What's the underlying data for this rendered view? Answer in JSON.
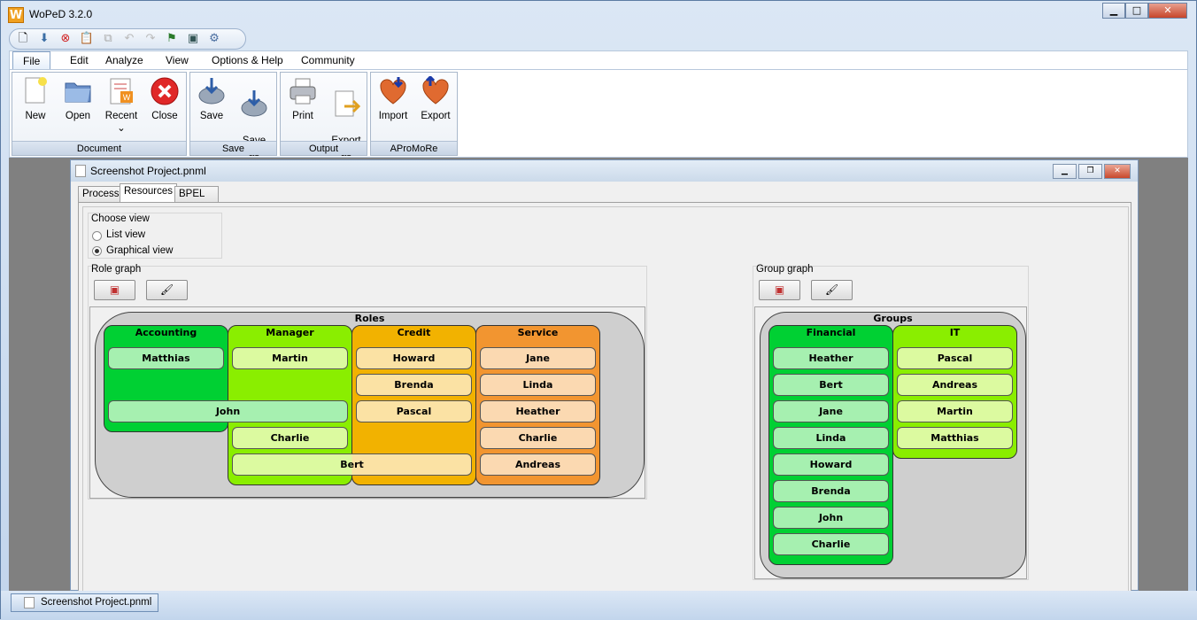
{
  "app": {
    "title": "WoPeD 3.2.0",
    "icon_letter": "W"
  },
  "window_buttons": [
    "minimize-icon",
    "maximize-icon",
    "close-icon"
  ],
  "quick_access": [
    "new-icon",
    "save-icon",
    "close-icon",
    "paste-icon",
    "copy-icon",
    "undo-icon",
    "redo-icon",
    "simulate-icon",
    "image-icon",
    "settings-icon"
  ],
  "menu": [
    "File",
    "Edit",
    "Analyze",
    "View",
    "Options & Help",
    "Community"
  ],
  "ribbon": {
    "groups": [
      {
        "label": "Document",
        "buttons": [
          {
            "label": "New",
            "icon": "new-doc-icon"
          },
          {
            "label": "Open",
            "icon": "folder-icon"
          },
          {
            "label": "Recent",
            "icon": "recent-icon",
            "dropdown": "⌄"
          },
          {
            "label": "Close",
            "icon": "close-icon"
          }
        ]
      },
      {
        "label": "Save",
        "buttons": [
          {
            "label": "Save",
            "icon": "save-icon"
          },
          {
            "label": "Save\nas",
            "icon": "save-as-icon"
          }
        ]
      },
      {
        "label": "Output",
        "buttons": [
          {
            "label": "Print",
            "icon": "printer-icon"
          },
          {
            "label": "Export\nas",
            "icon": "export-icon"
          }
        ]
      },
      {
        "label": "AProMoRe",
        "buttons": [
          {
            "label": "Import",
            "icon": "apromore-import-icon"
          },
          {
            "label": "Export",
            "icon": "apromore-export-icon"
          }
        ]
      }
    ]
  },
  "document": {
    "title": "Screenshot Project.pnml",
    "tabs": [
      "Process",
      "Resources",
      "BPEL preview"
    ],
    "active_tab": "Resources",
    "choose_view": {
      "legend": "Choose view",
      "options": [
        "List view",
        "Graphical view"
      ],
      "selected": "Graphical view"
    },
    "role_graph": {
      "legend": "Role graph",
      "title": "Roles",
      "lanes": [
        {
          "name": "Accounting",
          "color": "#00cc33",
          "members": [
            "Matthias",
            "John"
          ]
        },
        {
          "name": "Manager",
          "color": "#88ee00",
          "members": [
            "Martin",
            "John",
            "Charlie",
            "Bert"
          ]
        },
        {
          "name": "Credit",
          "color": "#f0b000",
          "members": [
            "Howard",
            "Brenda",
            "Pascal",
            "Bert"
          ]
        },
        {
          "name": "Service",
          "color": "#f09030",
          "members": [
            "Jane",
            "Linda",
            "Heather",
            "Charlie",
            "Andreas"
          ]
        }
      ]
    },
    "group_graph": {
      "legend": "Group graph",
      "title": "Groups",
      "lanes": [
        {
          "name": "Financial",
          "color": "#00cc33",
          "members": [
            "Heather",
            "Bert",
            "Jane",
            "Linda",
            "Howard",
            "Brenda",
            "John",
            "Charlie"
          ]
        },
        {
          "name": "IT",
          "color": "#88ee00",
          "members": [
            "Pascal",
            "Andreas",
            "Martin",
            "Matthias"
          ]
        }
      ]
    }
  },
  "taskbar": {
    "item": "Screenshot Project.pnml"
  }
}
